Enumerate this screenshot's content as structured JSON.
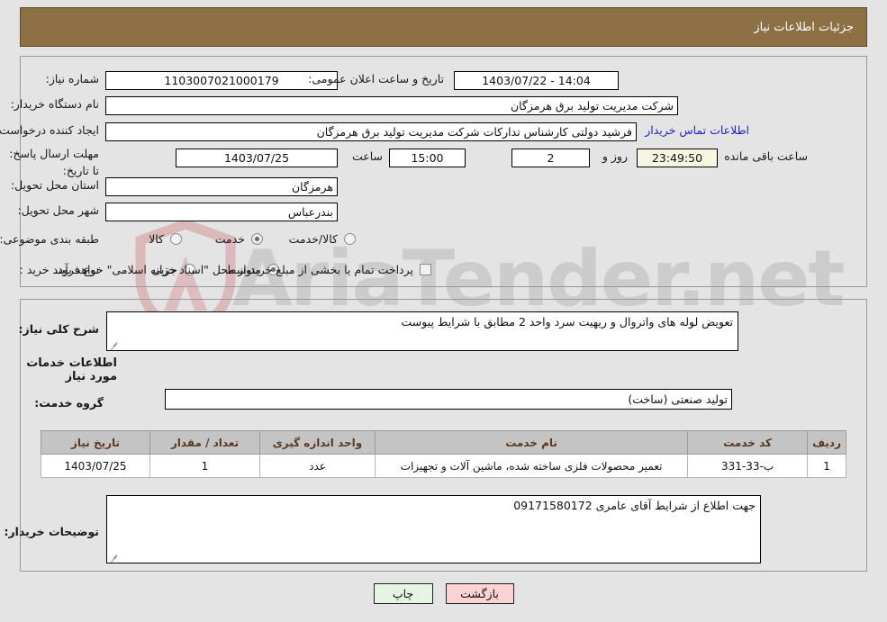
{
  "header": {
    "title": "جزئیات اطلاعات نیاز",
    "bar_color": "#8d7044"
  },
  "form": {
    "need_number": {
      "label": "شماره نیاز:",
      "value": "1103007021000179"
    },
    "public_announce": {
      "label": "تاریخ و ساعت اعلان عمومی:",
      "value": "14:04 - 1403/07/22"
    },
    "buyer_org": {
      "label": "نام دستگاه خریدار:",
      "value": "شرکت مدیریت تولید برق هرمزگان"
    },
    "request_creator": {
      "label": "ایجاد کننده درخواست:",
      "value": "فرشید دولتی کارشناس تدارکات شرکت مدیریت تولید برق هرمزگان"
    },
    "buyer_contact_link": "اطلاعات تماس خریدار",
    "deadline": {
      "label": "مهلت ارسال پاسخ: تا تاریخ:",
      "date": "1403/07/25",
      "time_label": "ساعت",
      "time": "15:00",
      "days": "2",
      "days_suffix": "روز و",
      "countdown": "23:49:50",
      "countdown_suffix": "ساعت باقی مانده"
    },
    "province": {
      "label": "استان محل تحویل:",
      "value": "هرمزگان"
    },
    "city": {
      "label": "شهر محل تحویل:",
      "value": "بندرعباس"
    },
    "category": {
      "label": "طبقه بندی موضوعی:",
      "options": [
        "کالا",
        "خدمت",
        "کالا/خدمت"
      ],
      "selected": "خدمت"
    },
    "purchase_process": {
      "label": "نوع فرآیند خرید :",
      "options": [
        "جزیی",
        "متوسط"
      ],
      "selected": "متوسط",
      "treasury_note": "پرداخت تمام یا بخشی از مبلغ خرید،از محل \"اسناد خزانه اسلامی\" خواهد بود.",
      "treasury_checked": false
    }
  },
  "description": {
    "label": "شرح کلی نیاز:",
    "value": "تعویض لوله های واتروال و ریهیت سرد واحد 2 مطابق با شرایط پیوست"
  },
  "services_section": {
    "heading": "اطلاعات خدمات مورد نیاز",
    "group": {
      "label": "گروه خدمت:",
      "value": "تولید صنعتی (ساخت)"
    }
  },
  "items_table": {
    "headers": [
      "ردیف",
      "کد خدمت",
      "نام خدمت",
      "واحد اندازه گیری",
      "تعداد / مقدار",
      "تاریخ نیاز"
    ],
    "rows": [
      {
        "row": "1",
        "code": "ب-33-331",
        "name": "تعمیر محصولات فلزی ساخته شده، ماشین آلات و تجهیزات",
        "unit": "عدد",
        "quantity": "1",
        "need_date": "1403/07/25"
      }
    ]
  },
  "buyer_notes": {
    "label": "توضیحات خریدار:",
    "value": "جهت اطلاع از شرایط آقای عامری 09171580172"
  },
  "buttons": {
    "print": "چاپ",
    "back": "بازگشت"
  },
  "watermark": {
    "text": "AriaTender.net"
  }
}
